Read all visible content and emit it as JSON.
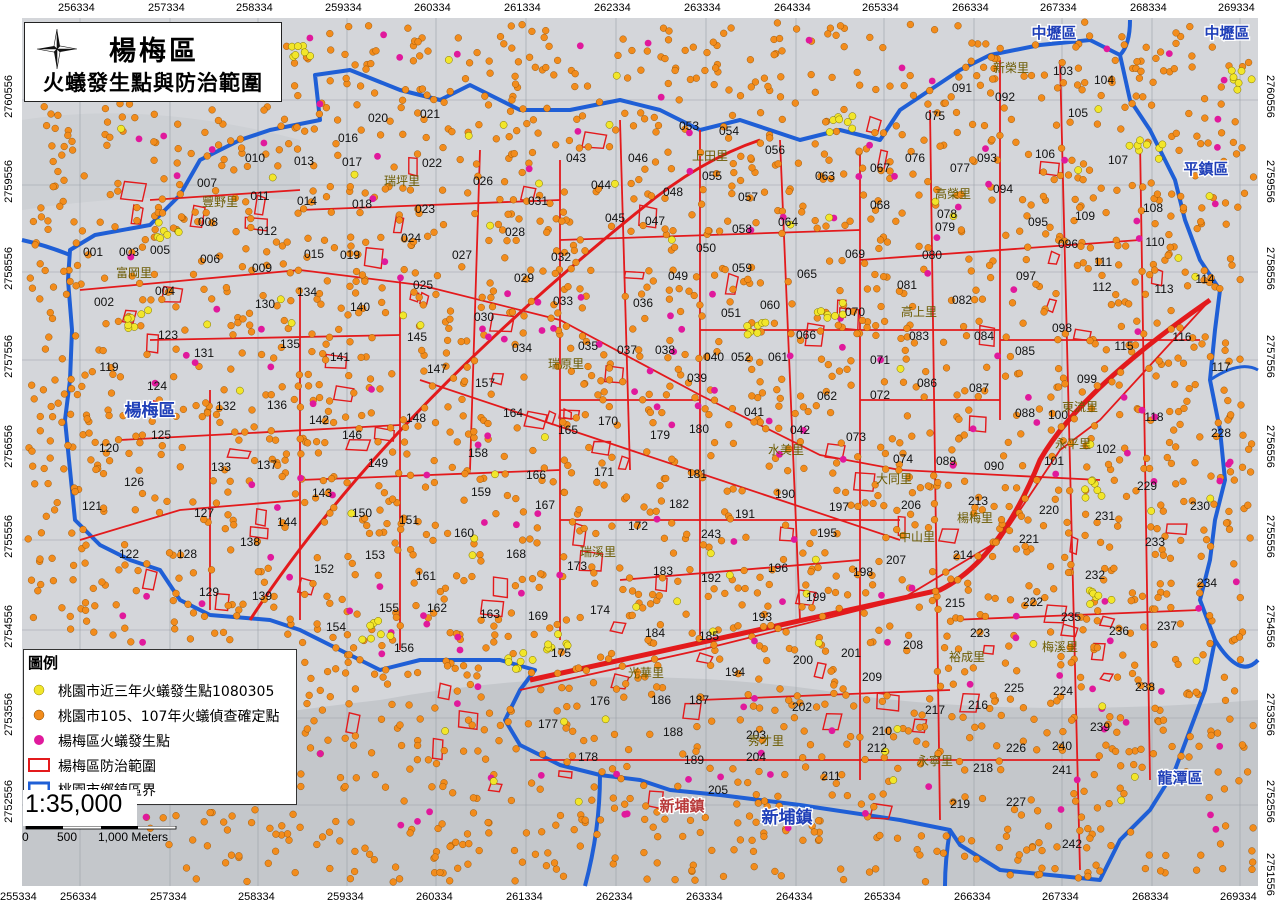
{
  "title": {
    "main": "楊梅區",
    "sub": "火蟻發生點與防治範圍"
  },
  "coords": {
    "top": [
      "256334",
      "257334",
      "258334",
      "259334",
      "260334",
      "261334",
      "262334",
      "263334",
      "264334",
      "265334",
      "266334",
      "267334",
      "268334",
      "269334"
    ],
    "bottom": [
      "255334",
      "256334",
      "257334",
      "258334",
      "259334",
      "260334",
      "261334",
      "262334",
      "263334",
      "264334",
      "265334",
      "266334",
      "267334",
      "268334",
      "269334"
    ],
    "left": [
      "2760556",
      "2759556",
      "2758556",
      "2757556",
      "2756556",
      "2755556",
      "2754556",
      "2753556",
      "2752556"
    ],
    "right": [
      "2760556",
      "2759556",
      "2758556",
      "2757556",
      "2756556",
      "2755556",
      "2754556",
      "2753556",
      "2752556",
      "2751556"
    ]
  },
  "districts": [
    {
      "name": "中壢區"
    },
    {
      "name": "中壢區"
    },
    {
      "name": "平鎮區"
    },
    {
      "name": "楊梅區"
    },
    {
      "name": "龍潭區"
    },
    {
      "name": "新埔鎮"
    },
    {
      "name": "新埔鎮"
    }
  ],
  "villages": [
    "新榮里",
    "高榮里",
    "瑞坪里",
    "秀才里",
    "梅溪里",
    "上田里",
    "高上里",
    "瑞原里",
    "水美里",
    "大同里",
    "裕成里",
    "永寧里",
    "永平里",
    "中山里",
    "楊梅里",
    "瑞溪里",
    "東流里",
    "光華里",
    "富岡里",
    "豐野里"
  ],
  "zones": [
    "001",
    "002",
    "003",
    "004",
    "005",
    "006",
    "007",
    "008",
    "009",
    "010",
    "011",
    "012",
    "013",
    "014",
    "015",
    "016",
    "017",
    "018",
    "019",
    "020",
    "021",
    "022",
    "023",
    "024",
    "025",
    "026",
    "027",
    "028",
    "029",
    "030",
    "031",
    "032",
    "033",
    "034",
    "035",
    "036",
    "037",
    "038",
    "039",
    "040",
    "041",
    "042",
    "043",
    "044",
    "045",
    "046",
    "047",
    "048",
    "049",
    "050",
    "051",
    "052",
    "053",
    "054",
    "055",
    "056",
    "057",
    "058",
    "059",
    "060",
    "061",
    "062",
    "063",
    "064",
    "065",
    "066",
    "067",
    "068",
    "069",
    "070",
    "071",
    "072",
    "073",
    "074",
    "075",
    "076",
    "077",
    "078",
    "079",
    "080",
    "081",
    "082",
    "083",
    "084",
    "085",
    "086",
    "087",
    "088",
    "089",
    "090",
    "091",
    "092",
    "093",
    "094",
    "095",
    "096",
    "097",
    "098",
    "099",
    "100",
    "101",
    "102",
    "103",
    "104",
    "105",
    "106",
    "107",
    "108",
    "109",
    "110",
    "111",
    "112",
    "113",
    "114",
    "115",
    "116",
    "117",
    "118",
    "119",
    "120",
    "121",
    "122",
    "123",
    "124",
    "125",
    "126",
    "127",
    "128",
    "129",
    "130",
    "131",
    "132",
    "133",
    "134",
    "135",
    "136",
    "137",
    "138",
    "139",
    "140",
    "141",
    "142",
    "143",
    "144",
    "145",
    "146",
    "147",
    "148",
    "149",
    "150",
    "151",
    "152",
    "153",
    "154",
    "155",
    "156",
    "157",
    "158",
    "159",
    "160",
    "161",
    "162",
    "163",
    "164",
    "165",
    "166",
    "167",
    "168",
    "169",
    "170",
    "171",
    "172",
    "173",
    "174",
    "175",
    "176",
    "177",
    "178",
    "179",
    "180",
    "181",
    "182",
    "183",
    "184",
    "185",
    "186",
    "187",
    "188",
    "189",
    "190",
    "191",
    "192",
    "193",
    "194",
    "195",
    "196",
    "197",
    "198",
    "199",
    "200",
    "201",
    "202",
    "203",
    "204",
    "205",
    "206",
    "207",
    "208",
    "209",
    "210",
    "211",
    "212",
    "213",
    "214",
    "215",
    "216",
    "217",
    "218",
    "219",
    "220",
    "221",
    "222",
    "223",
    "224",
    "225",
    "226",
    "227",
    "228",
    "229",
    "230",
    "231",
    "232",
    "233",
    "234",
    "235",
    "236",
    "237",
    "238",
    "239",
    "240",
    "241",
    "242",
    "243"
  ],
  "legend": {
    "title": "圖例",
    "items": [
      {
        "label": "桃園市近三年火蟻發生點1080305",
        "color": "#f2e62a",
        "symbol": "dot"
      },
      {
        "label": "桃園市105、107年火蟻偵查確定點",
        "color": "#f28c1c",
        "symbol": "dot"
      },
      {
        "label": "楊梅區火蟻發生點",
        "color": "#e0199c",
        "symbol": "dot"
      },
      {
        "label": "楊梅區防治範圍",
        "color": "#e31a1c",
        "symbol": "rect"
      },
      {
        "label": "桃園市鄉鎮區界",
        "color": "#1f5fd6",
        "symbol": "line"
      }
    ]
  },
  "scale": {
    "ratio": "1:35,000",
    "ticks": [
      "0",
      "500",
      "1,000 Meters"
    ]
  },
  "colors": {
    "boundary": "#1f5fd6",
    "zone": "#e31a1c",
    "base": "#d6d8dc",
    "district_label": "#1f3fb8"
  }
}
